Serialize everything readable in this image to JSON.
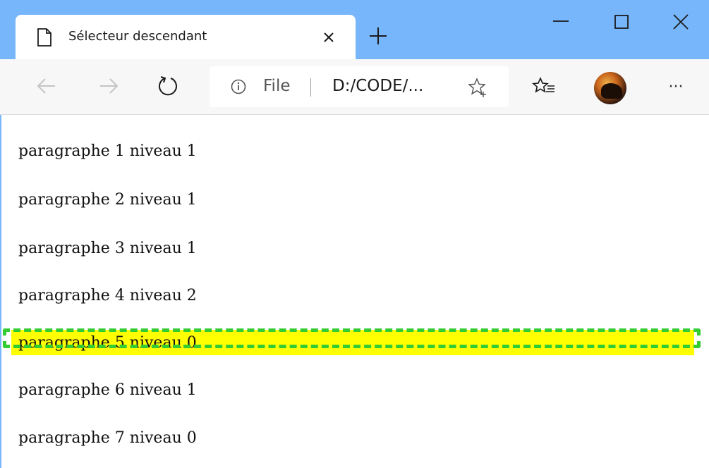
{
  "browser": {
    "tab": {
      "title": "Sélecteur descendant",
      "close_label": "×",
      "page_icon": "page-icon",
      "close_icon": "close-icon"
    },
    "new_tab_icon": "plus-icon",
    "window_controls": {
      "minimize_icon": "minimize-icon",
      "maximize_icon": "maximize-icon",
      "close_icon": "close-icon"
    },
    "toolbar": {
      "back_icon": "arrow-left-icon",
      "forward_icon": "arrow-right-icon",
      "refresh_icon": "refresh-icon",
      "address": {
        "info_icon": "info-icon",
        "scheme": "File",
        "url": "D:/CODE/..."
      },
      "favorite_icon": "star-plus-icon",
      "favorites_list_icon": "favorites-list-icon",
      "avatar_icon": "profile-avatar-icon",
      "more_label": "···"
    },
    "colors": {
      "titlebar": "#77b6fb",
      "highlight": "#ffff00",
      "outline": "#33cc33"
    }
  },
  "page": {
    "paragraphs": [
      "paragraphe 1 niveau 1",
      "paragraphe 2 niveau 1",
      "paragraphe 3 niveau 1",
      "paragraphe 4 niveau 2",
      "paragraphe 5 niveau 0",
      "paragraphe 6 niveau 1",
      "paragraphe 7 niveau 0"
    ],
    "highlighted_index": 4
  }
}
